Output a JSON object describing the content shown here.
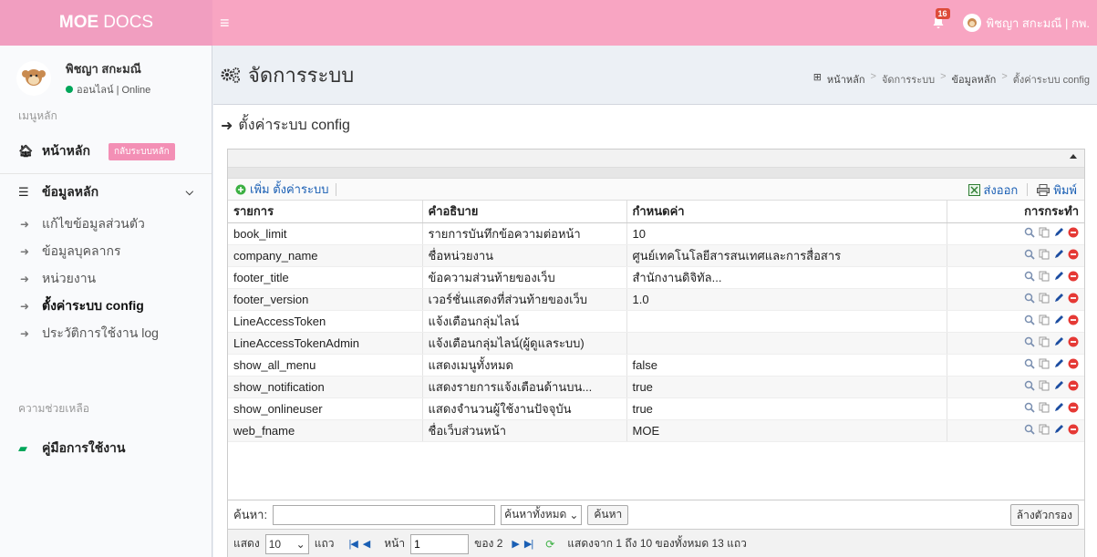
{
  "topbar": {
    "brand_bold": "MOE",
    "brand_rest": "DOCS",
    "notif_count": "16",
    "user_label": "พิชญา สกะมณี | กพ."
  },
  "sidebar": {
    "user_name": "พิชญา สกะมณี",
    "user_status": "ออนไลน์ | Online",
    "menu_header": "เมนูหลัก",
    "home_label": "หน้าหลัก",
    "home_pill": "กลับระบบหลัก",
    "data_label": "ข้อมูลหลัก",
    "sub_items": [
      "แก้ไขข้อมูลส่วนตัว",
      "ข้อมูลบุคลากร",
      "หน่วยงาน",
      "ตั้งค่าระบบ config",
      "ประวัติการใช้งาน log"
    ],
    "help_header": "ความช่วยเหลือ",
    "manual_label": "คู่มือการใช้งาน"
  },
  "page": {
    "title": "จัดการระบบ",
    "breadcrumb": [
      "หน้าหลัก",
      "จัดการระบบ",
      "ข้อมูลหลัก",
      "ตั้งค่าระบบ config"
    ],
    "box_title": "ตั้งค่าระบบ config"
  },
  "grid": {
    "add_label": "เพิ่ม ตั้งค่าระบบ",
    "export_label": "ส่งออก",
    "print_label": "พิมพ์",
    "columns": [
      "รายการ",
      "คำอธิบาย",
      "กำหนดค่า",
      "การกระทำ"
    ],
    "rows": [
      [
        "book_limit",
        "รายการบันทึกข้อความต่อหน้า",
        "10"
      ],
      [
        "company_name",
        "ชื่อหน่วยงาน",
        "ศูนย์เทคโนโลยีสารสนเทศและการสื่อสาร"
      ],
      [
        "footer_title",
        "ข้อความส่วนท้ายของเว็บ",
        "สำนักงานดิจิทัล..."
      ],
      [
        "footer_version",
        "เวอร์ชั่นแสดงที่ส่วนท้ายของเว็บ",
        "1.0"
      ],
      [
        "LineAccessToken",
        "แจ้งเตือนกลุ่มไลน์",
        ""
      ],
      [
        "LineAccessTokenAdmin",
        "แจ้งเตือนกลุ่มไลน์(ผู้ดูแลระบบ)",
        ""
      ],
      [
        "show_all_menu",
        "แสดงเมนูทั้งหมด",
        "false"
      ],
      [
        "show_notification",
        "แสดงรายการแจ้งเตือนด้านบน...",
        "true"
      ],
      [
        "show_onlineuser",
        "แสดงจำนวนผู้ใช้งานปัจจุบัน",
        "true"
      ],
      [
        "web_fname",
        "ชื่อเว็บส่วนหน้า",
        "MOE"
      ]
    ],
    "search_label": "ค้นหา:",
    "search_value": "",
    "search_scope": "ค้นหาทั้งหมด",
    "search_button": "ค้นหา",
    "reset_button": "ล้างตัวกรอง",
    "show_label": "แสดง",
    "page_size": "10",
    "rows_label": "แถว",
    "page_label": "หน้า",
    "page_value": "1",
    "of_label": "ของ 2",
    "summary": "แสดงจาก 1 ถึง 10 ของทั้งหมด 13 แถว"
  }
}
